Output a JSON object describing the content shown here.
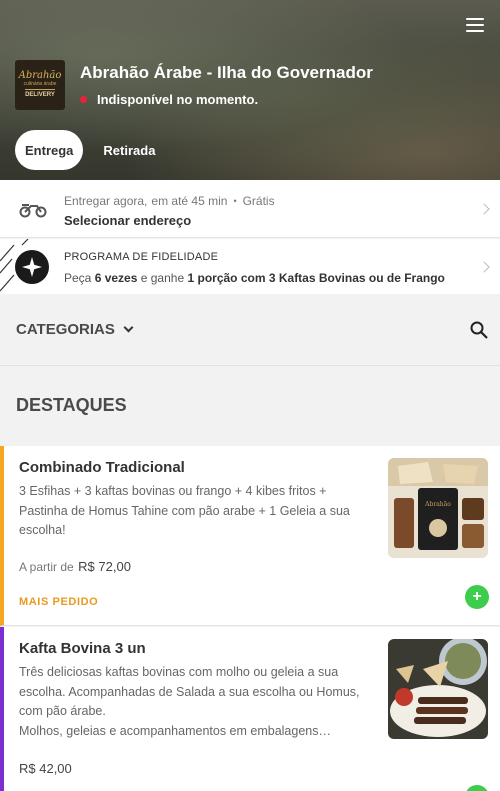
{
  "header": {
    "restaurant_name": "Abrahão Árabe - Ilha do Governador",
    "status_text": "Indisponível no momento.",
    "logo_text": {
      "line1": "Abrahão",
      "line2": "culinária árabe",
      "line3": "DELIVERY"
    },
    "tabs": [
      {
        "label": "Entrega",
        "active": true
      },
      {
        "label": "Retirada",
        "active": false
      }
    ],
    "menu_icon": "hamburger-icon",
    "status_color": "#e8223a"
  },
  "delivery": {
    "when": "Entregar agora,",
    "eta": "em até 45 min",
    "separator": "•",
    "fee": "Grátis",
    "address_action": "Selecionar endereço",
    "icon": "motorcycle-icon"
  },
  "loyalty": {
    "title": "PROGRAMA DE FIDELIDADE",
    "text_prefix": "Peça",
    "count": "6 vezes",
    "text_middle": "e ganhe",
    "reward": "1 porção com 3 Kaftas Bovinas ou de Frango",
    "icon": "sparkle-icon"
  },
  "categories": {
    "label": "CATEGORIAS",
    "search_icon": "search-icon"
  },
  "section": {
    "title": "DESTAQUES"
  },
  "products": [
    {
      "name": "Combinado Tradicional",
      "description": "3 Esfihas + 3 kaftas bovinas ou frango + 4 kibes fritos + Pastinha de Homus Tahine com pão arabe + 1 Geleia a sua escolha!",
      "price_prefix": "A partir de",
      "price": "R$ 72,00",
      "badge": "MAIS PEDIDO",
      "accent_color": "#f5a623",
      "add_label": "+"
    },
    {
      "name": "Kafta Bovina 3 un",
      "description": "Três deliciosas kaftas bovinas com molho ou geleia a sua escolha. Acompanhadas de Salada a sua escolha ou Homus, com pão árabe.",
      "description2": "Molhos, geleias e acompanhamentos em embalagens…",
      "price": "R$ 42,00",
      "accent_color": "#7b2fd1",
      "add_label": "+"
    }
  ],
  "colors": {
    "add_button": "#3ccd4d",
    "badge_text": "#e89a1f"
  }
}
